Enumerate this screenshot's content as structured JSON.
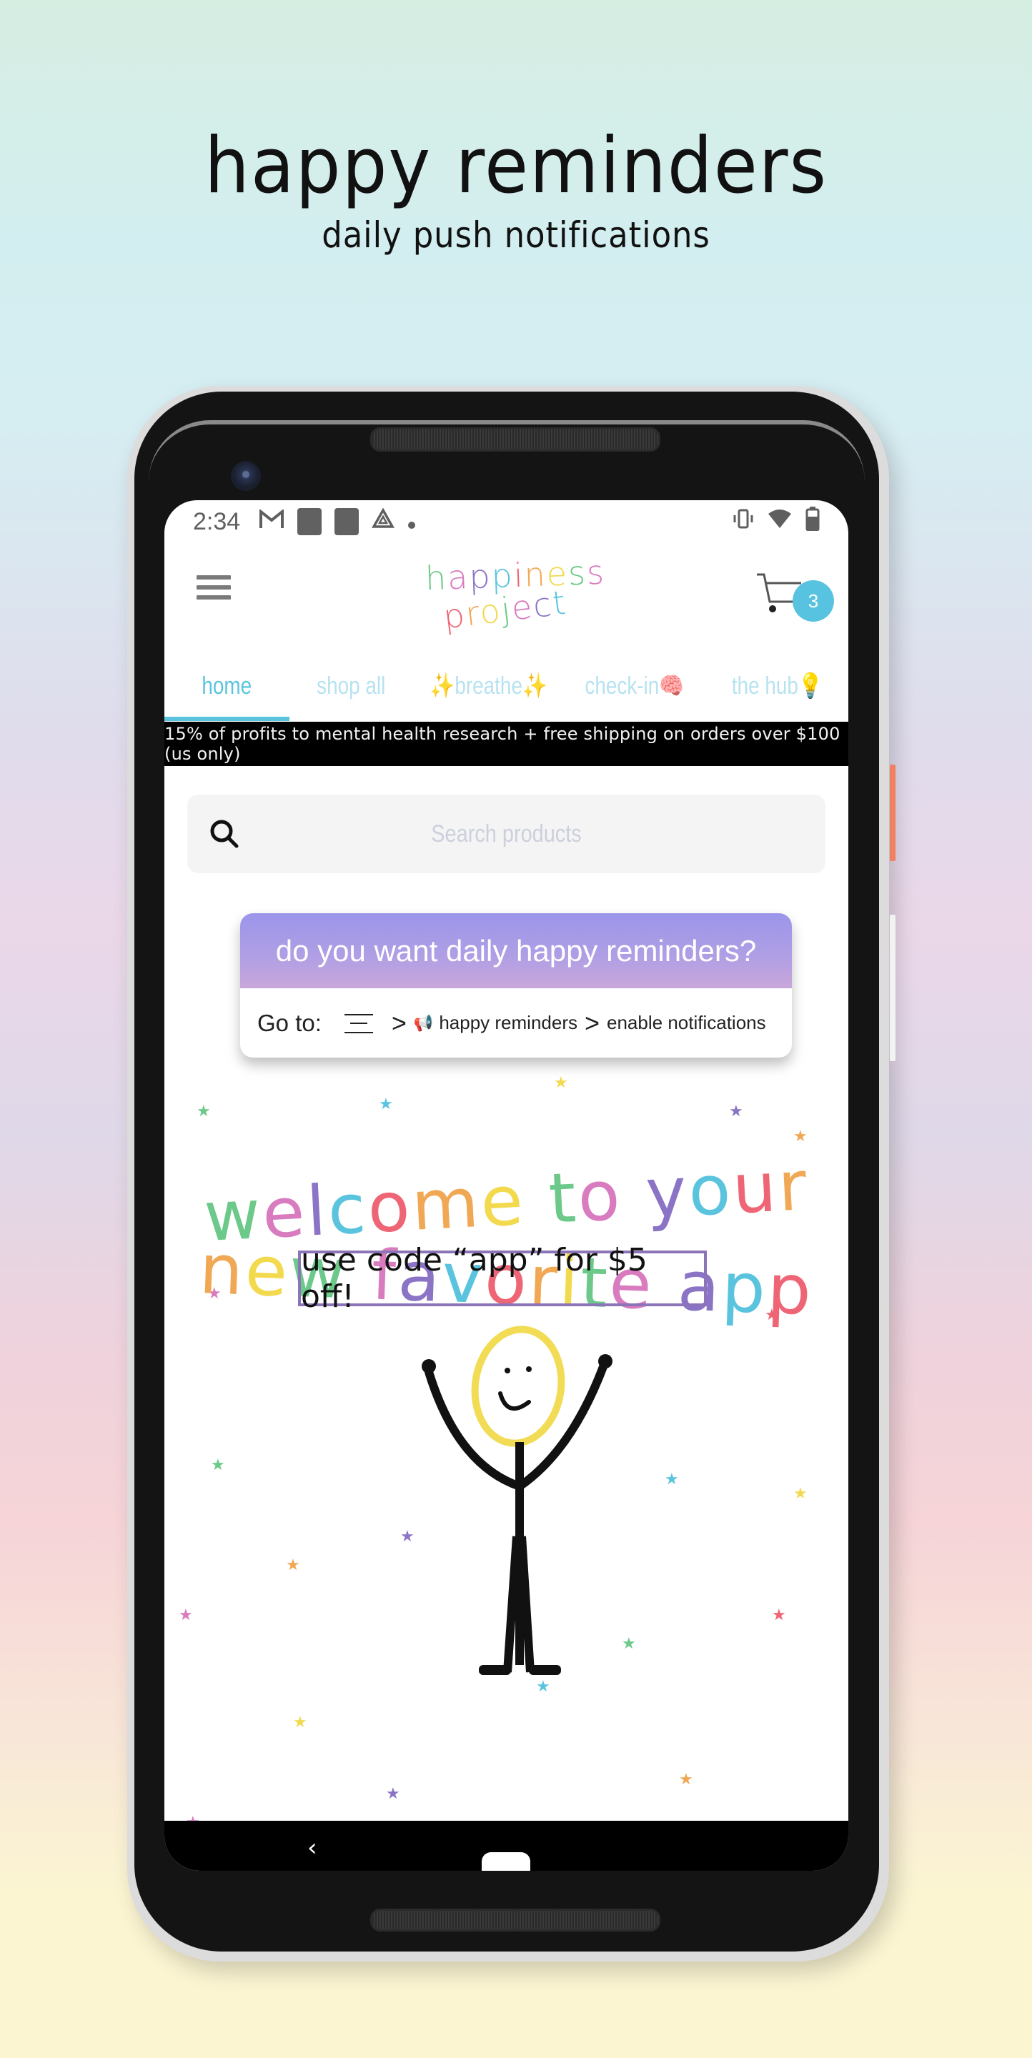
{
  "promo": {
    "title": "happy reminders",
    "subtitle": "daily push notifications"
  },
  "status_bar": {
    "time": "2:34",
    "left_icons": [
      "gmail-icon",
      "app-icon",
      "app-icon",
      "drive-icon",
      "dot-icon"
    ],
    "right_icons": [
      "vibrate-icon",
      "wifi-icon",
      "battery-icon"
    ]
  },
  "header": {
    "logo_line1": "happiness",
    "logo_line2": "project",
    "cart_count": "3"
  },
  "tabs": [
    {
      "label": "home",
      "active": true
    },
    {
      "label": "shop all",
      "active": false
    },
    {
      "label": "✨breathe✨",
      "active": false
    },
    {
      "label": "check-in🧠",
      "active": false
    },
    {
      "label": "the hub💡",
      "active": false
    }
  ],
  "banner": {
    "text": "15% of profits to mental health research + free shipping on orders over $100 (us only)"
  },
  "search": {
    "placeholder": "Search products",
    "value": ""
  },
  "reminder_card": {
    "title": "do you want daily happy reminders?",
    "goto_label": "Go to:",
    "step1": "happy reminders",
    "step2": "enable notifications",
    "separator": ">"
  },
  "hero": {
    "line1": "welcome to your",
    "line2": "new favorite app",
    "code_text": "use code “app” for $5 off!"
  },
  "colors": {
    "accent": "#5ac4df",
    "tab_inactive": "#b7e2f0",
    "card_gradient_top": "#9b95ea",
    "card_gradient_bottom": "#c9a7da",
    "code_border": "#8b74b8",
    "rainbow": [
      "#6cc98a",
      "#d97bbf",
      "#8b74c6",
      "#5ac4df",
      "#ee6675",
      "#f0a855",
      "#f2d94e"
    ]
  },
  "navigation": {
    "back": "‹"
  }
}
